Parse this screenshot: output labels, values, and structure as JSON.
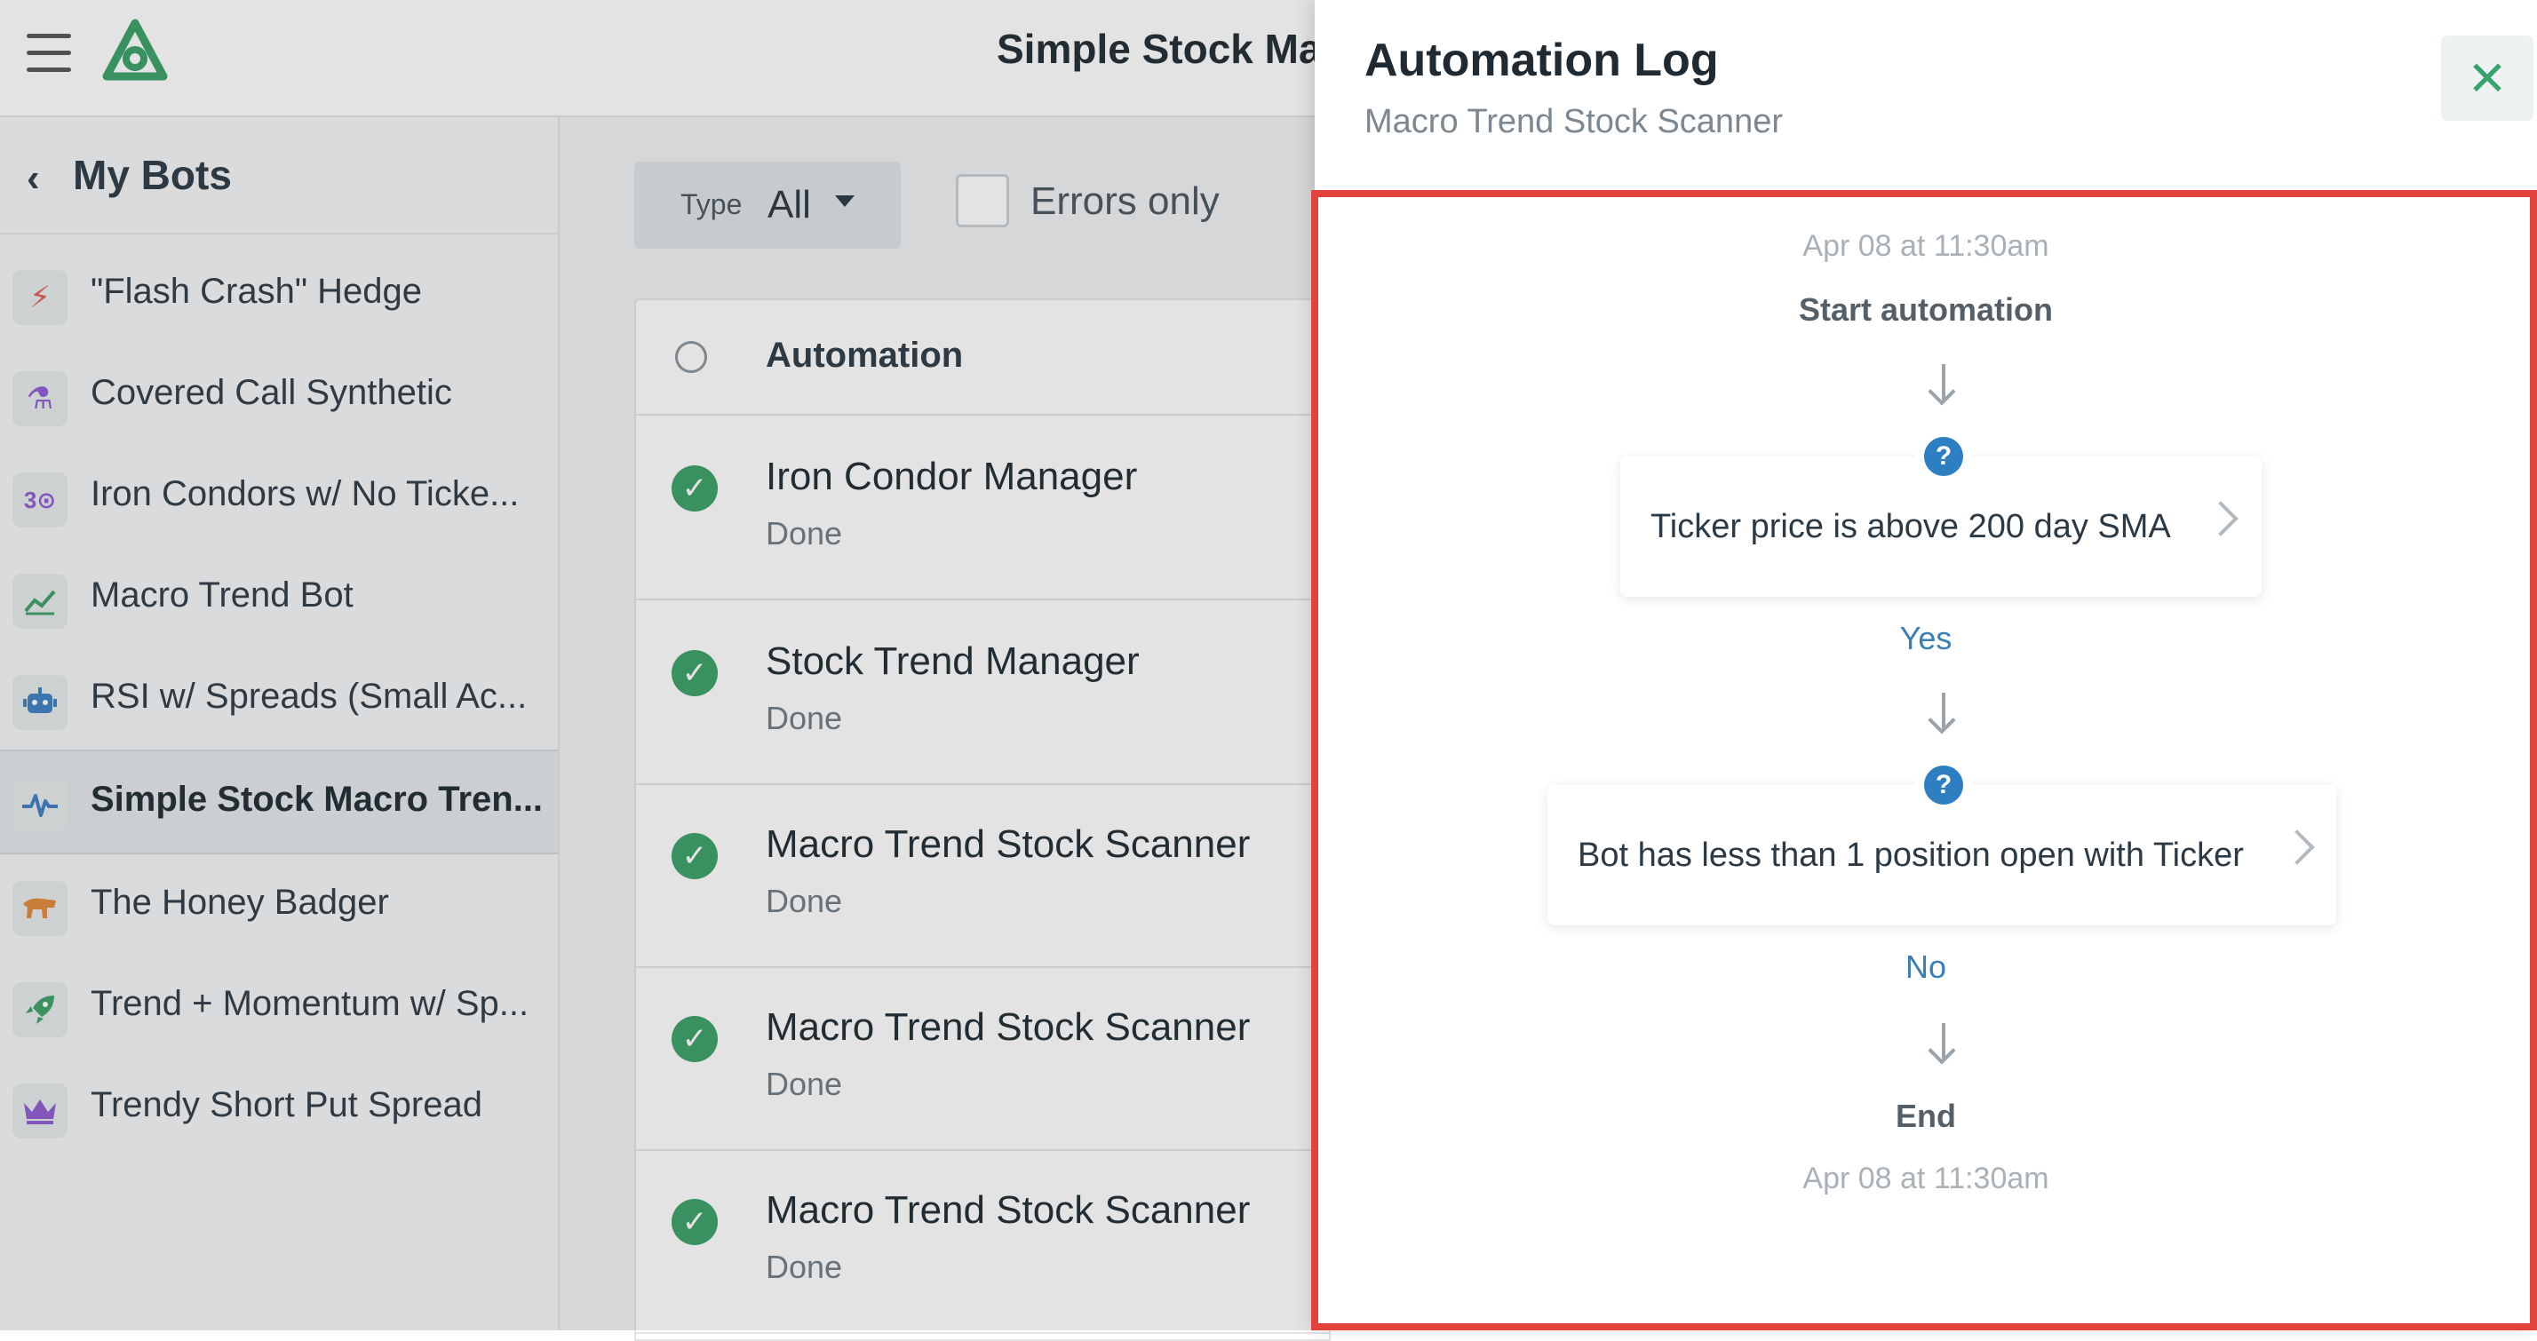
{
  "header": {
    "title": "Simple Stock Ma"
  },
  "sidebar": {
    "back_label": "My Bots",
    "items": [
      {
        "label": "\"Flash Crash\" Hedge",
        "icon": "lightning-icon",
        "glyph": "⚡",
        "color": "#e05a4f"
      },
      {
        "label": "Covered Call Synthetic",
        "icon": "flask-icon",
        "glyph": "⚗",
        "color": "#8e5bd0"
      },
      {
        "label": "Iron Condors w/ No Ticke...",
        "icon": "condor-icon",
        "glyph": "3⊙",
        "color": "#8e5bd0"
      },
      {
        "label": "Macro Trend Bot",
        "icon": "line-chart-icon",
        "glyph": "📈",
        "color": "#3aa066"
      },
      {
        "label": "RSI w/ Spreads (Small Ac...",
        "icon": "robot-icon",
        "glyph": "⊞",
        "color": "#3d7fc2"
      },
      {
        "label": "Simple Stock Macro Tren...",
        "icon": "pulse-icon",
        "glyph": "〰",
        "color": "#3d7fc2",
        "active": true
      },
      {
        "label": "The Honey Badger",
        "icon": "badger-icon",
        "glyph": "🐾",
        "color": "#e08a3a"
      },
      {
        "label": "Trend + Momentum w/ Sp...",
        "icon": "rocket-icon",
        "glyph": "🚀",
        "color": "#3aa066"
      },
      {
        "label": "Trendy Short Put Spread",
        "icon": "crown-icon",
        "glyph": "♛",
        "color": "#8e5bd0"
      }
    ]
  },
  "filters": {
    "type_label": "Type",
    "type_value": "All",
    "errors_label": "Errors only"
  },
  "table": {
    "column_header": "Automation",
    "rows": [
      {
        "title": "Iron Condor Manager",
        "status": "Done"
      },
      {
        "title": "Stock Trend Manager",
        "status": "Done"
      },
      {
        "title": "Macro Trend Stock Scanner",
        "status": "Done"
      },
      {
        "title": "Macro Trend Stock Scanner",
        "status": "Done"
      },
      {
        "title": "Macro Trend Stock Scanner",
        "status": "Done"
      }
    ]
  },
  "panel": {
    "title": "Automation Log",
    "subtitle": "Macro Trend Stock Scanner",
    "close_symbol": "✕",
    "flow": {
      "start_time": "Apr 08 at 11:30am",
      "start_label": "Start automation",
      "condition1": "Ticker price is above 200 day SMA",
      "branch1": "Yes",
      "condition2": "Bot has less than 1 position open with Ticker",
      "branch2": "No",
      "end_label": "End",
      "end_time": "Apr 08 at 11:30am"
    }
  },
  "colors": {
    "accent_green": "#3aa066",
    "highlight_red": "#e2443b",
    "branch_blue": "#3c7fb4",
    "question_blue": "#2d7fc1"
  }
}
